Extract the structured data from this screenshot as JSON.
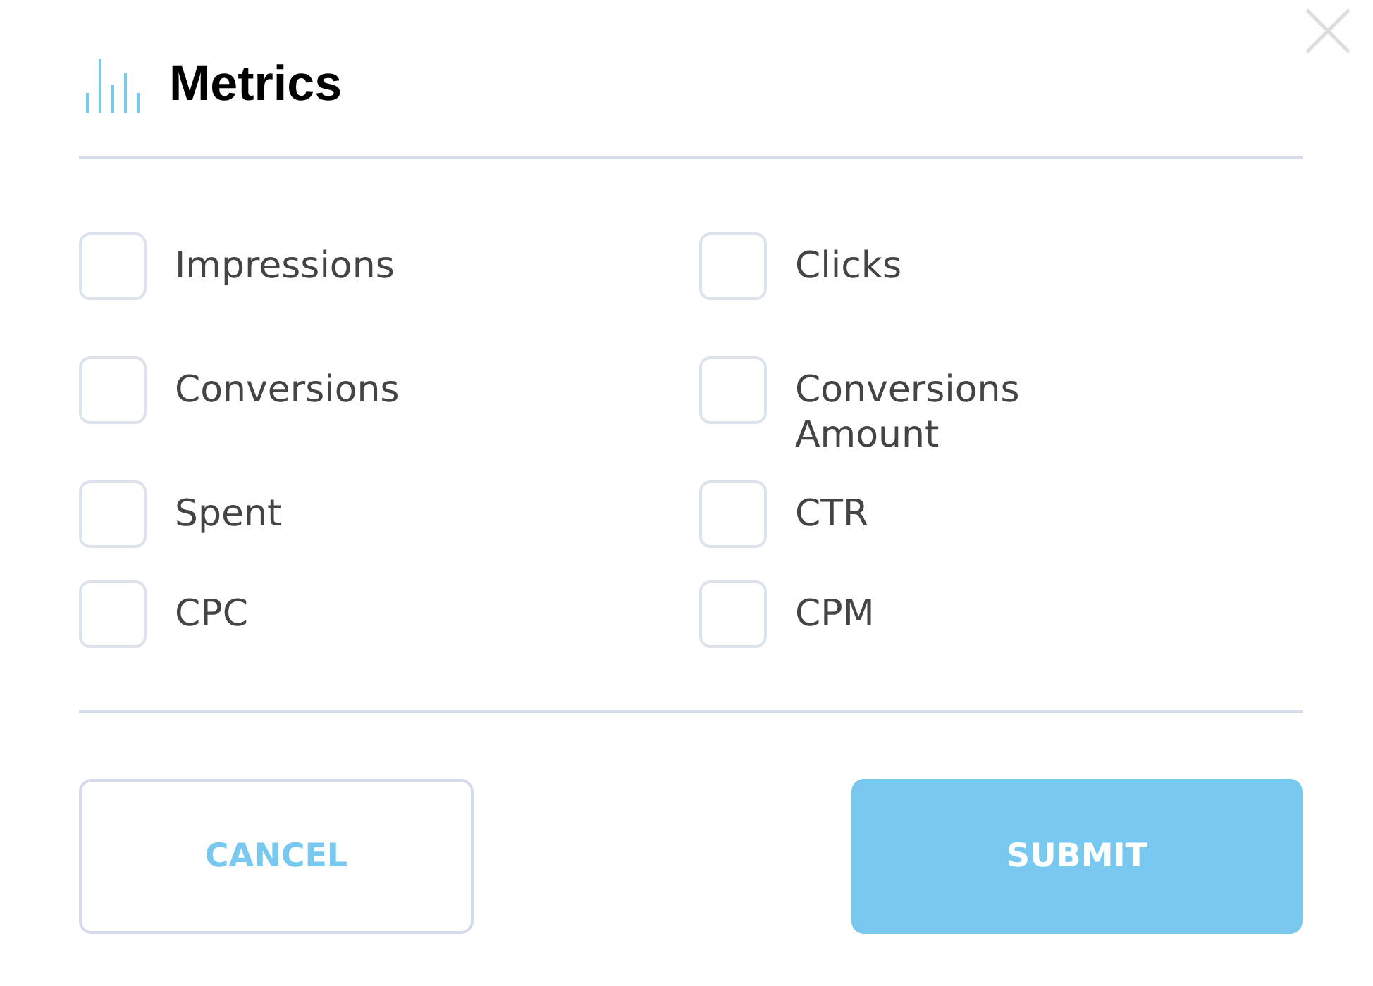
{
  "title": "Metrics",
  "metrics": [
    {
      "label": "Impressions",
      "checked": false
    },
    {
      "label": "Clicks",
      "checked": false
    },
    {
      "label": "Conversions",
      "checked": false
    },
    {
      "label": "Conversions Amount",
      "checked": false
    },
    {
      "label": "Spent",
      "checked": false
    },
    {
      "label": "CTR",
      "checked": false
    },
    {
      "label": "CPC",
      "checked": false
    },
    {
      "label": "CPM",
      "checked": false
    }
  ],
  "buttons": [
    {
      "label": "CANCEL",
      "kind": "secondary"
    },
    {
      "label": "SUBMIT",
      "kind": "primary"
    }
  ]
}
